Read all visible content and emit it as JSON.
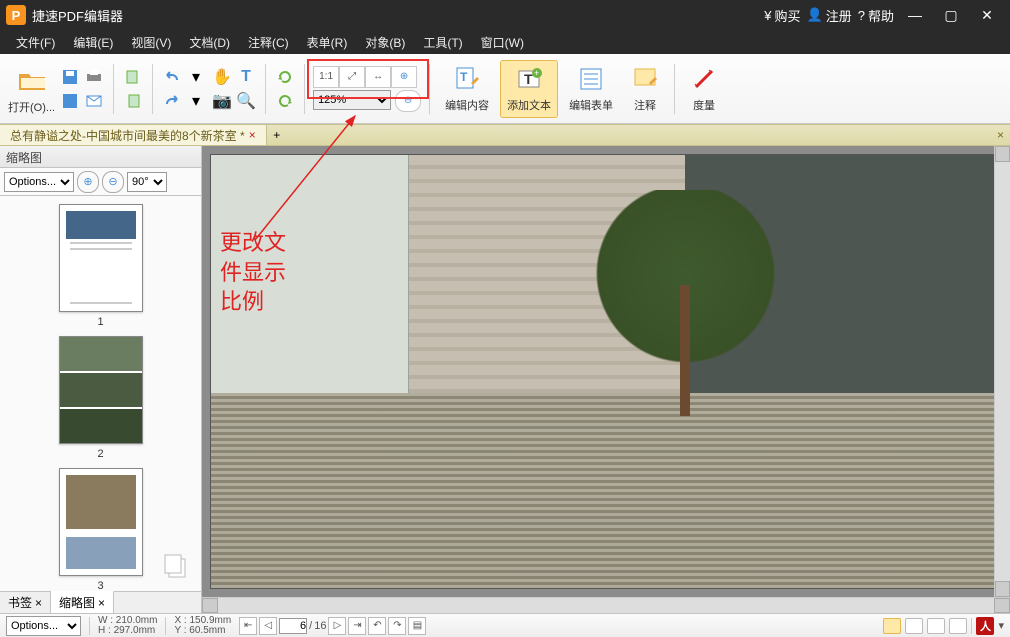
{
  "app_title": "捷速PDF编辑器",
  "title_right": {
    "buy": "购买",
    "register": "注册",
    "help": "帮助"
  },
  "menu": [
    "文件(F)",
    "编辑(E)",
    "视图(V)",
    "文档(D)",
    "注释(C)",
    "表单(R)",
    "对象(B)",
    "工具(T)",
    "窗口(W)"
  ],
  "toolbar": {
    "open_label": "打开(O)...",
    "zoom_value": "125%",
    "edit_content": "编辑内容",
    "add_text": "添加文本",
    "edit_form": "编辑表单",
    "annotate": "注释",
    "measure": "度量"
  },
  "tab": {
    "name": "总有静谥之处-中国城市间最美的8个新茶室 *"
  },
  "sidebar": {
    "title": "缩略图",
    "options": "Options...",
    "rotate": "90°",
    "pages": [
      "1",
      "2",
      "3"
    ],
    "bottom_tabs": {
      "bookmark": "书签",
      "thumb": "缩略图"
    }
  },
  "annotation_text": "更改文\n件显示\n比例",
  "status": {
    "options": "Options...",
    "w_label": "W :",
    "w_val": "210.0mm",
    "h_label": "H :",
    "h_val": "297.0mm",
    "x_label": "X :",
    "x_val": "150.9mm",
    "y_label": "Y :",
    "y_val": "60.5mm",
    "page_current": "6",
    "page_total": "16"
  }
}
